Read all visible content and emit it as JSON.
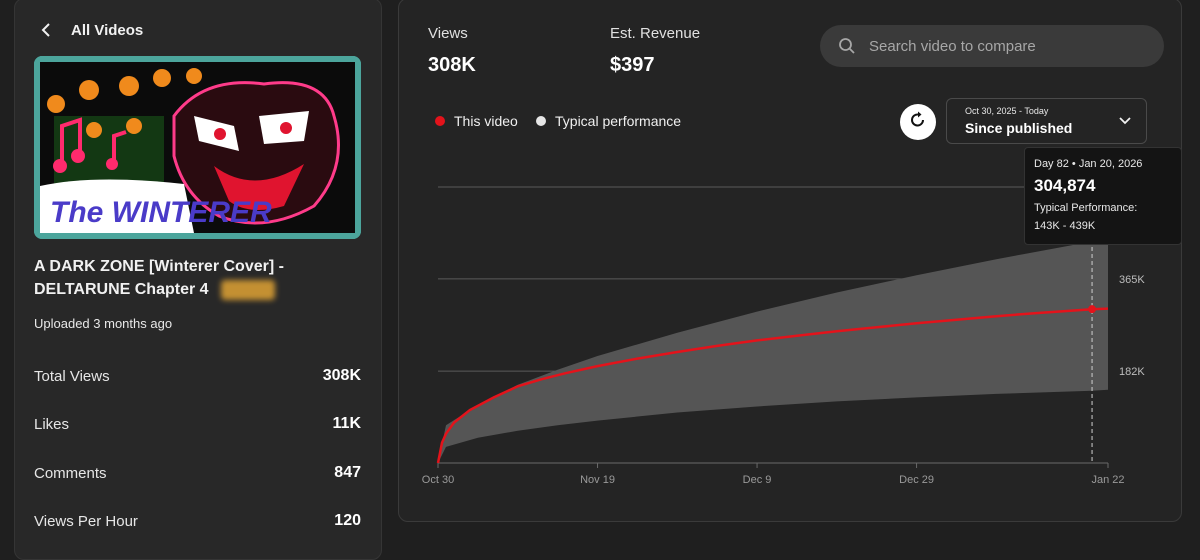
{
  "nav": {
    "back_label": "All Videos"
  },
  "video": {
    "title": "A DARK ZONE [Winterer Cover] - DELTARUNE Chapter 4",
    "uploaded": "Uploaded 3 months ago",
    "thumbnail_text": "The WINTERER"
  },
  "stats": [
    {
      "label": "Total Views",
      "value": "308K"
    },
    {
      "label": "Likes",
      "value": "11K"
    },
    {
      "label": "Comments",
      "value": "847"
    },
    {
      "label": "Views Per Hour",
      "value": "120"
    }
  ],
  "metrics": {
    "views_label": "Views",
    "views_value": "308K",
    "revenue_label": "Est. Revenue",
    "revenue_value": "$397"
  },
  "search": {
    "placeholder": "Search video to compare",
    "icon": "search-icon"
  },
  "legend": {
    "this_video": "This video",
    "this_video_color": "#e3131b",
    "typical": "Typical performance",
    "typical_color": "#e6e6e6"
  },
  "range": {
    "dates": "Oct 30, 2025 - Today",
    "label": "Since published"
  },
  "tooltip": {
    "header": "Day 82 • Jan 20, 2026",
    "value": "304,874",
    "typical_label": "Typical Performance:",
    "typical_range": "143K - 439K"
  },
  "chart_data": {
    "type": "line",
    "x_ticks": [
      "Oct 30",
      "Nov 19",
      "Dec 9",
      "Dec 29",
      "Jan 22"
    ],
    "x_tick_days": [
      0,
      20,
      40,
      60,
      84
    ],
    "xlim": [
      0,
      84
    ],
    "y_ticks": [
      {
        "value": 182000,
        "label": "182K"
      },
      {
        "value": 365000,
        "label": "365K"
      }
    ],
    "y_gridlines": [
      182000,
      365000,
      547000
    ],
    "ylim": [
      0,
      547000
    ],
    "hover_day": 82,
    "series": [
      {
        "name": "This video",
        "color": "#e3131b",
        "points": [
          [
            0,
            0
          ],
          [
            0.5,
            40000
          ],
          [
            1,
            58000
          ],
          [
            2,
            80000
          ],
          [
            4,
            105000
          ],
          [
            7,
            130000
          ],
          [
            10,
            152000
          ],
          [
            13,
            166000
          ],
          [
            16,
            178000
          ],
          [
            20,
            192000
          ],
          [
            25,
            207000
          ],
          [
            30,
            220000
          ],
          [
            35,
            232000
          ],
          [
            40,
            243000
          ],
          [
            45,
            252000
          ],
          [
            50,
            261000
          ],
          [
            55,
            269000
          ],
          [
            60,
            277000
          ],
          [
            65,
            284000
          ],
          [
            70,
            291000
          ],
          [
            75,
            297000
          ],
          [
            82,
            304874
          ],
          [
            84,
            306000
          ]
        ]
      }
    ],
    "band": {
      "name": "Typical performance",
      "color": "#555555",
      "upper": [
        [
          0,
          0
        ],
        [
          1,
          75000
        ],
        [
          5,
          115000
        ],
        [
          10,
          155000
        ],
        [
          15,
          185000
        ],
        [
          20,
          212000
        ],
        [
          30,
          258000
        ],
        [
          40,
          300000
        ],
        [
          50,
          338000
        ],
        [
          60,
          372000
        ],
        [
          70,
          404000
        ],
        [
          82,
          439000
        ],
        [
          84,
          444000
        ]
      ],
      "lower": [
        [
          0,
          0
        ],
        [
          1,
          32000
        ],
        [
          5,
          50000
        ],
        [
          10,
          64000
        ],
        [
          15,
          75000
        ],
        [
          20,
          84000
        ],
        [
          30,
          100000
        ],
        [
          40,
          112000
        ],
        [
          50,
          122000
        ],
        [
          60,
          130000
        ],
        [
          70,
          137000
        ],
        [
          82,
          143000
        ],
        [
          84,
          145000
        ]
      ]
    }
  }
}
